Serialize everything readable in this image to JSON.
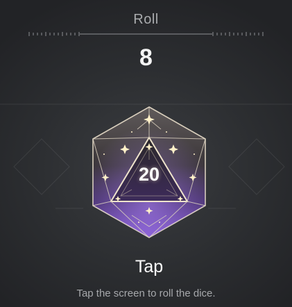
{
  "header": {
    "title": "Roll",
    "value": "8"
  },
  "dice": {
    "type": "d20",
    "face_value": "20",
    "icon": "d20-dice-icon",
    "colors": {
      "body_top": "#5f5a5a",
      "body_bottom": "#6b3fb5",
      "edge": "#e8dcc2",
      "sparkle": "#fff1c9"
    }
  },
  "action": {
    "label": "Tap",
    "hint": "Tap the screen to roll the dice."
  }
}
